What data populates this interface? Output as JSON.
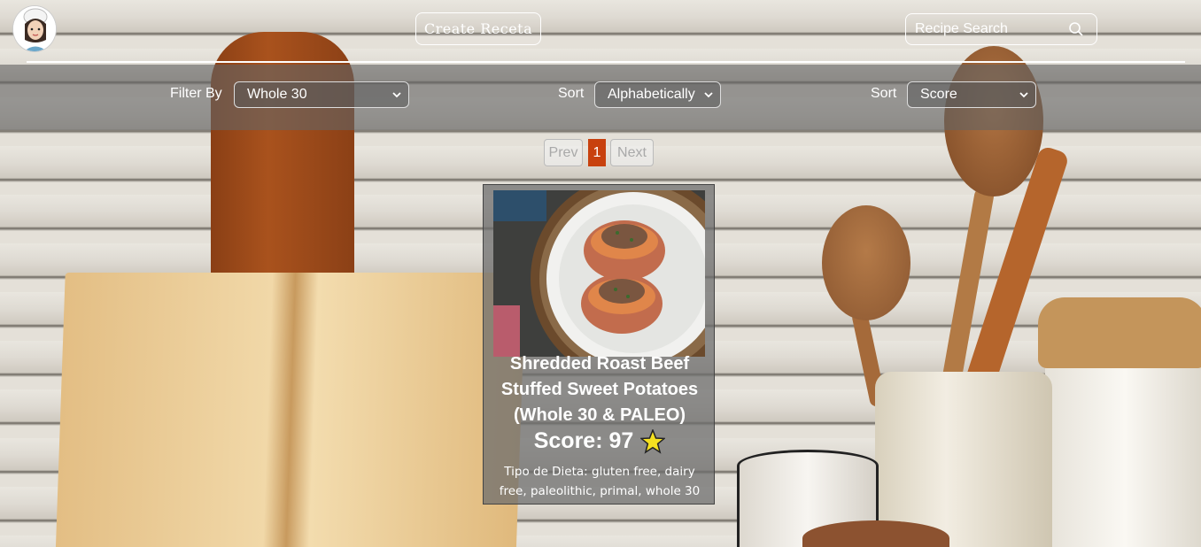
{
  "header": {
    "create_button": "Create Receta",
    "search_placeholder": "Recipe Search"
  },
  "filters": {
    "filter_label": "Filter By",
    "filter_value": "Whole 30",
    "sort1_label": "Sort",
    "sort1_value": "Alphabetically",
    "sort2_label": "Sort",
    "sort2_value": "Score"
  },
  "pagination": {
    "prev": "Prev",
    "current": "1",
    "next": "Next"
  },
  "recipe": {
    "title": "Shredded Roast Beef Stuffed Sweet Potatoes (Whole 30 & PALEO)",
    "score": "Score: 97",
    "diet": "Tipo de Dieta: gluten free, dairy free, paleolithic, primal, whole 30"
  },
  "colors": {
    "active_page": "#c8410e",
    "card_bg": "#6e6e6e",
    "filter_bar": "#646464"
  }
}
